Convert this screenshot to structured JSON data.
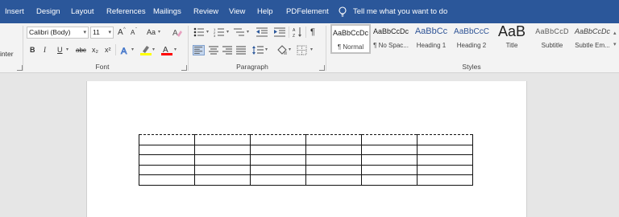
{
  "tabs": [
    "Insert",
    "Design",
    "Layout",
    "References",
    "Mailings",
    "Review",
    "View",
    "Help",
    "PDFelement"
  ],
  "tell_me": "Tell me what you want to do",
  "clipboard": {
    "format_painter_partial": "inter"
  },
  "font": {
    "name": "Calibri (Body)",
    "size": "11",
    "grow": "A",
    "shrink": "A",
    "case": "Aa",
    "bold": "B",
    "italic": "I",
    "underline": "U",
    "strikethrough": "abc",
    "subscript": "x₂",
    "superscript": "x²",
    "group_label": "Font"
  },
  "paragraph": {
    "pilcrow": "¶",
    "group_label": "Paragraph"
  },
  "styles": {
    "group_label": "Styles",
    "items": [
      {
        "sample": "AaBbCcDc",
        "name": "¶ Normal"
      },
      {
        "sample": "AaBbCcDc",
        "name": "¶ No Spac..."
      },
      {
        "sample": "AaBbCc",
        "name": "Heading 1"
      },
      {
        "sample": "AaBbCcC",
        "name": "Heading 2"
      },
      {
        "sample": "AaB",
        "name": "Title"
      },
      {
        "sample": "AaBbCcD",
        "name": "Subtitle"
      },
      {
        "sample": "AaBbCcDc",
        "name": "Subtle Em..."
      }
    ]
  },
  "colors": {
    "accent": "#2b579a",
    "highlight": "#ffff00",
    "font_color": "#ff0000"
  },
  "document": {
    "table": {
      "rows": 5,
      "cols": 6
    }
  }
}
